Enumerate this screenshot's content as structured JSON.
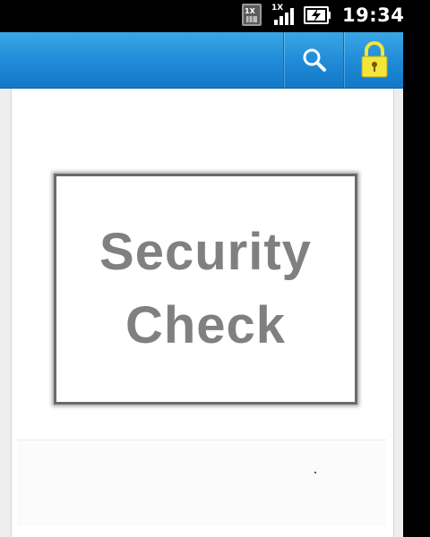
{
  "status_bar": {
    "time": "19:34",
    "sim_badge": "1X",
    "network_badge": "1X",
    "icons": [
      "sim-icon",
      "signal-icon",
      "battery-charging-icon"
    ]
  },
  "action_bar": {
    "background_color": "#1f8ad6",
    "actions": [
      {
        "icon": "search-icon"
      },
      {
        "icon": "lock-icon",
        "color": "#f3e53b"
      }
    ]
  },
  "security_check": {
    "line1": "Security",
    "line2": "Check",
    "text_color": "#808080",
    "frame_color": "#6a6a6a"
  }
}
